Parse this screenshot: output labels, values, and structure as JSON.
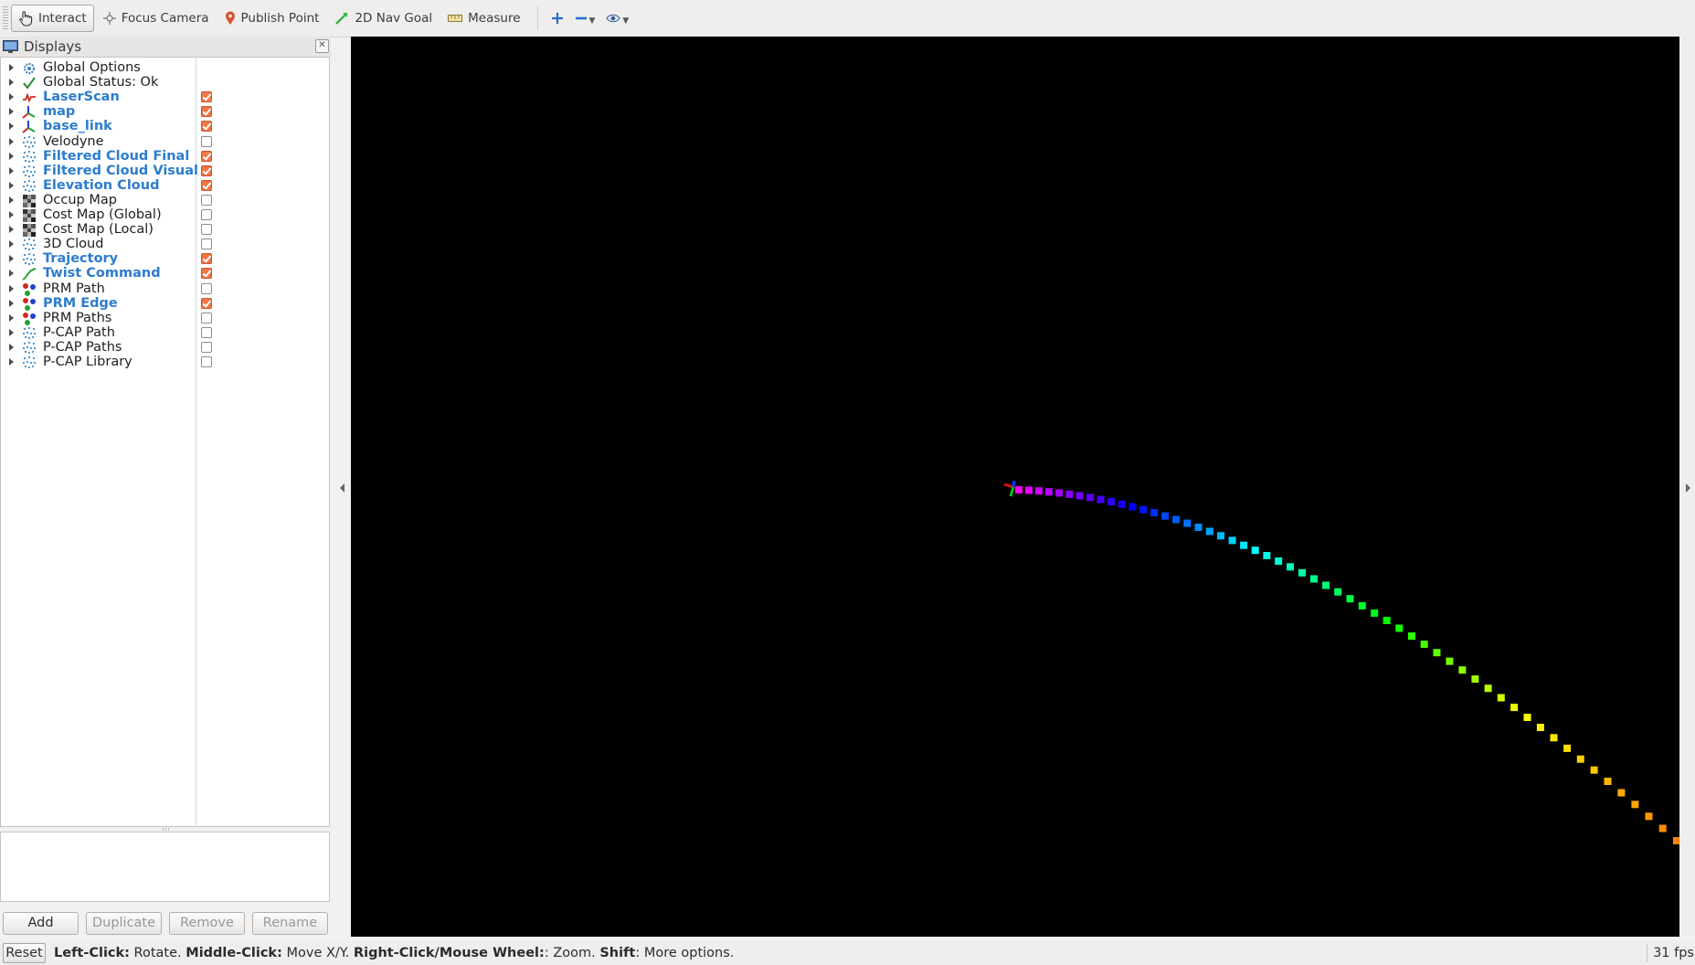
{
  "toolbar": {
    "tools": [
      {
        "label": "Interact",
        "icon": "hand-pointer-icon",
        "active": true
      },
      {
        "label": "Focus Camera",
        "icon": "crosshair-icon",
        "active": false
      },
      {
        "label": "Publish Point",
        "icon": "map-pin-icon",
        "active": false
      },
      {
        "label": "2D Nav Goal",
        "icon": "green-arrow-icon",
        "active": false
      },
      {
        "label": "Measure",
        "icon": "ruler-icon",
        "active": false
      }
    ],
    "extra_icons": [
      "plus-icon",
      "minus-dropdown-icon",
      "eye-dropdown-icon"
    ]
  },
  "displays_panel": {
    "title": "Displays",
    "items": [
      {
        "label": "Global Options",
        "icon": "gear-icon",
        "enabled": false,
        "has_checkbox": false
      },
      {
        "label": "Global Status: Ok",
        "icon": "checkmark-icon",
        "enabled": false,
        "has_checkbox": false
      },
      {
        "label": "LaserScan",
        "icon": "laserscan-icon",
        "enabled": true,
        "has_checkbox": true,
        "checked": true
      },
      {
        "label": "map",
        "icon": "axes-icon",
        "enabled": true,
        "has_checkbox": true,
        "checked": true
      },
      {
        "label": "base_link",
        "icon": "axes-icon",
        "enabled": true,
        "has_checkbox": true,
        "checked": true
      },
      {
        "label": "Velodyne",
        "icon": "pointcloud-icon",
        "enabled": false,
        "has_checkbox": true,
        "checked": false
      },
      {
        "label": "Filtered Cloud Final",
        "icon": "pointcloud-icon",
        "enabled": true,
        "has_checkbox": true,
        "checked": true
      },
      {
        "label": "Filtered Cloud Visual",
        "icon": "pointcloud-icon",
        "enabled": true,
        "has_checkbox": true,
        "checked": true
      },
      {
        "label": "Elevation Cloud",
        "icon": "pointcloud-icon",
        "enabled": true,
        "has_checkbox": true,
        "checked": true
      },
      {
        "label": "Occup Map",
        "icon": "grid-map-icon",
        "enabled": false,
        "has_checkbox": true,
        "checked": false
      },
      {
        "label": "Cost Map (Global)",
        "icon": "grid-map-icon",
        "enabled": false,
        "has_checkbox": true,
        "checked": false
      },
      {
        "label": "Cost Map (Local)",
        "icon": "grid-map-icon",
        "enabled": false,
        "has_checkbox": true,
        "checked": false
      },
      {
        "label": "3D Cloud",
        "icon": "pointcloud-icon",
        "enabled": false,
        "has_checkbox": true,
        "checked": false
      },
      {
        "label": "Trajectory",
        "icon": "pointcloud-icon",
        "enabled": true,
        "has_checkbox": true,
        "checked": true
      },
      {
        "label": "Twist Command",
        "icon": "path-line-icon",
        "enabled": true,
        "has_checkbox": true,
        "checked": true
      },
      {
        "label": "PRM Path",
        "icon": "marker-icon",
        "enabled": false,
        "has_checkbox": true,
        "checked": false
      },
      {
        "label": "PRM Edge",
        "icon": "marker-icon",
        "enabled": true,
        "has_checkbox": true,
        "checked": true
      },
      {
        "label": "PRM Paths",
        "icon": "marker-icon",
        "enabled": false,
        "has_checkbox": true,
        "checked": false
      },
      {
        "label": "P-CAP Path",
        "icon": "pointcloud-icon",
        "enabled": false,
        "has_checkbox": true,
        "checked": false
      },
      {
        "label": "P-CAP Paths",
        "icon": "pointcloud-icon",
        "enabled": false,
        "has_checkbox": true,
        "checked": false
      },
      {
        "label": "P-CAP Library",
        "icon": "pointcloud-icon",
        "enabled": false,
        "has_checkbox": true,
        "checked": false
      }
    ],
    "buttons": {
      "add": "Add",
      "duplicate": "Duplicate",
      "remove": "Remove",
      "rename": "Rename"
    }
  },
  "viewport": {
    "background": "#000000",
    "trajectory_gradient": [
      "#ff00ff",
      "#0000ff",
      "#00ffff",
      "#00ff00",
      "#ffff00",
      "#ff8000"
    ]
  },
  "statusbar": {
    "reset_label": "Reset",
    "hint_parts": [
      {
        "bold": true,
        "text": "Left-Click:"
      },
      {
        "bold": false,
        "text": " Rotate. "
      },
      {
        "bold": true,
        "text": "Middle-Click:"
      },
      {
        "bold": false,
        "text": " Move X/Y. "
      },
      {
        "bold": true,
        "text": "Right-Click/Mouse Wheel:"
      },
      {
        "bold": false,
        "text": ": Zoom. "
      },
      {
        "bold": true,
        "text": "Shift"
      },
      {
        "bold": false,
        "text": ": More options."
      }
    ],
    "fps": "31 fps"
  },
  "colors": {
    "enabled_label": "#2d7ccd",
    "checkbox_checked": "#f07746"
  }
}
